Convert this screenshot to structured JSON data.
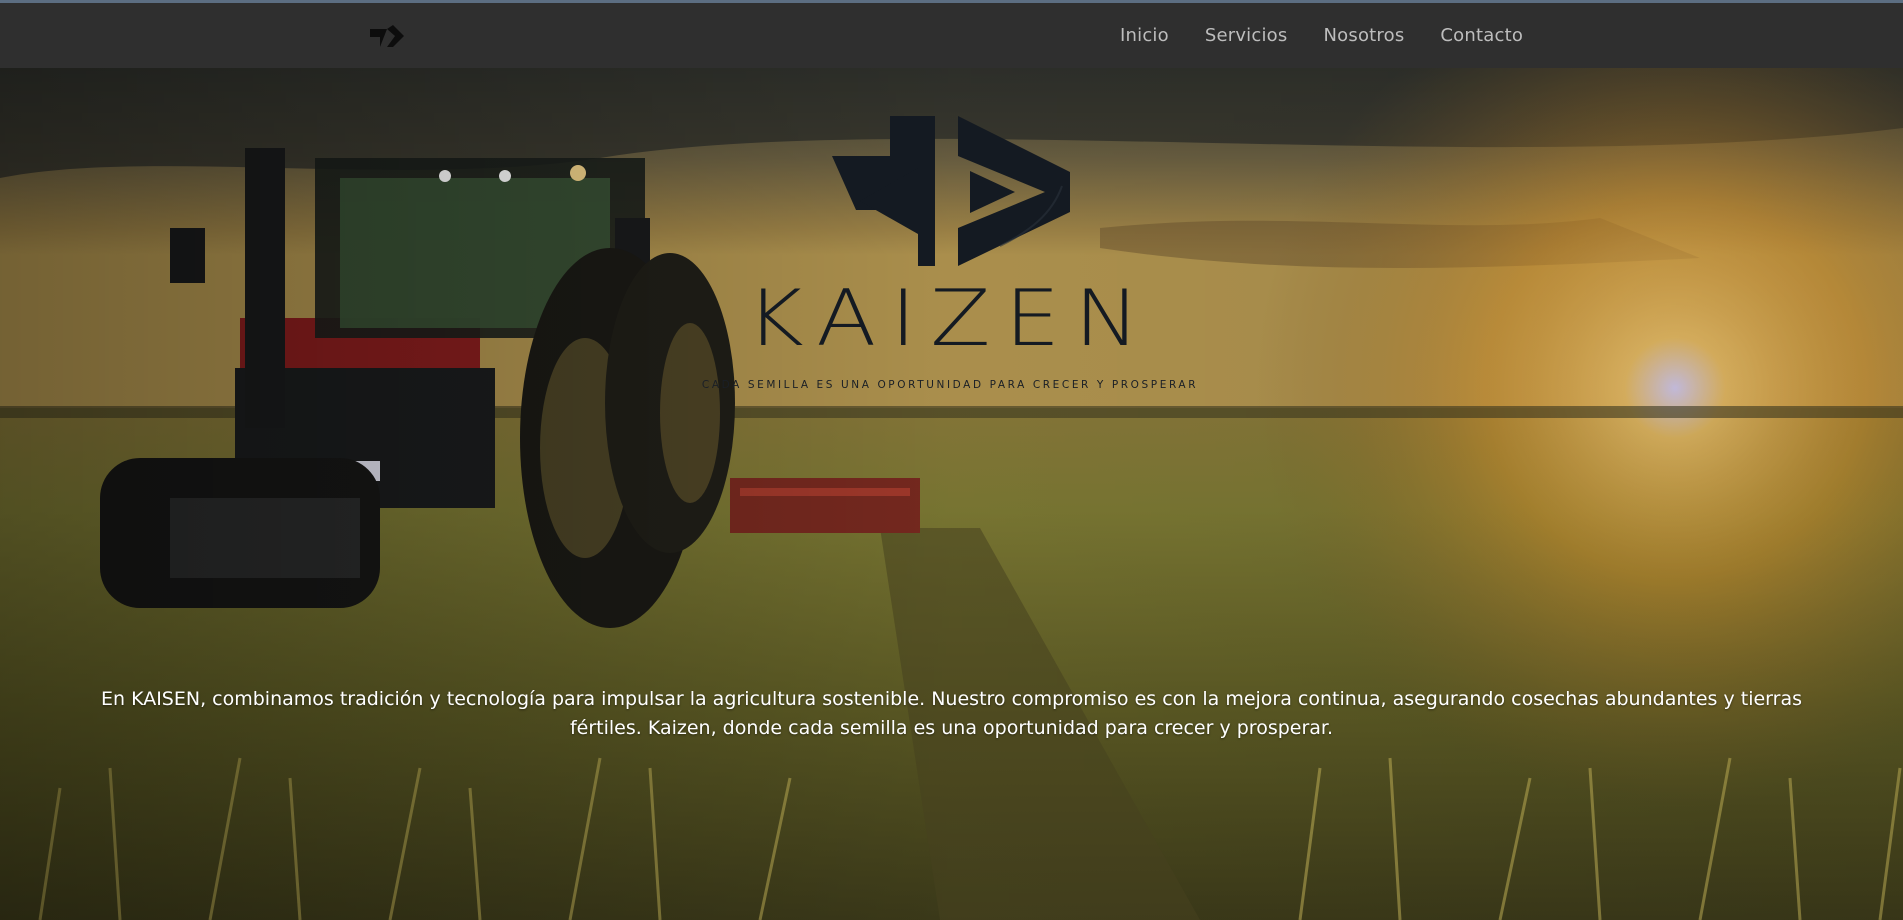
{
  "nav": {
    "logo_icon": "kaizen-logo-icon",
    "links": [
      {
        "label": "Inicio"
      },
      {
        "label": "Servicios"
      },
      {
        "label": "Nosotros"
      },
      {
        "label": "Contacto"
      }
    ]
  },
  "hero": {
    "brand_name": "KAIZEN",
    "tagline": "Cada semilla es una oportunidad para crecer y prosperar",
    "description": "En KAISEN, combinamos tradición y tecnología para impulsar la agricultura sostenible. Nuestro compromiso es con la mejora continua, asegurando cosechas abundantes y tierras fértiles. Kaizen, donde cada semilla es una oportunidad para crecer y prosperar.",
    "background": "tractor-in-wheat-field-sunset-photo"
  },
  "colors": {
    "navbar": "#2f2f2f",
    "nav_text": "#bdbdbd",
    "brand_dark": "#141a22",
    "hero_text": "#ffffff"
  }
}
